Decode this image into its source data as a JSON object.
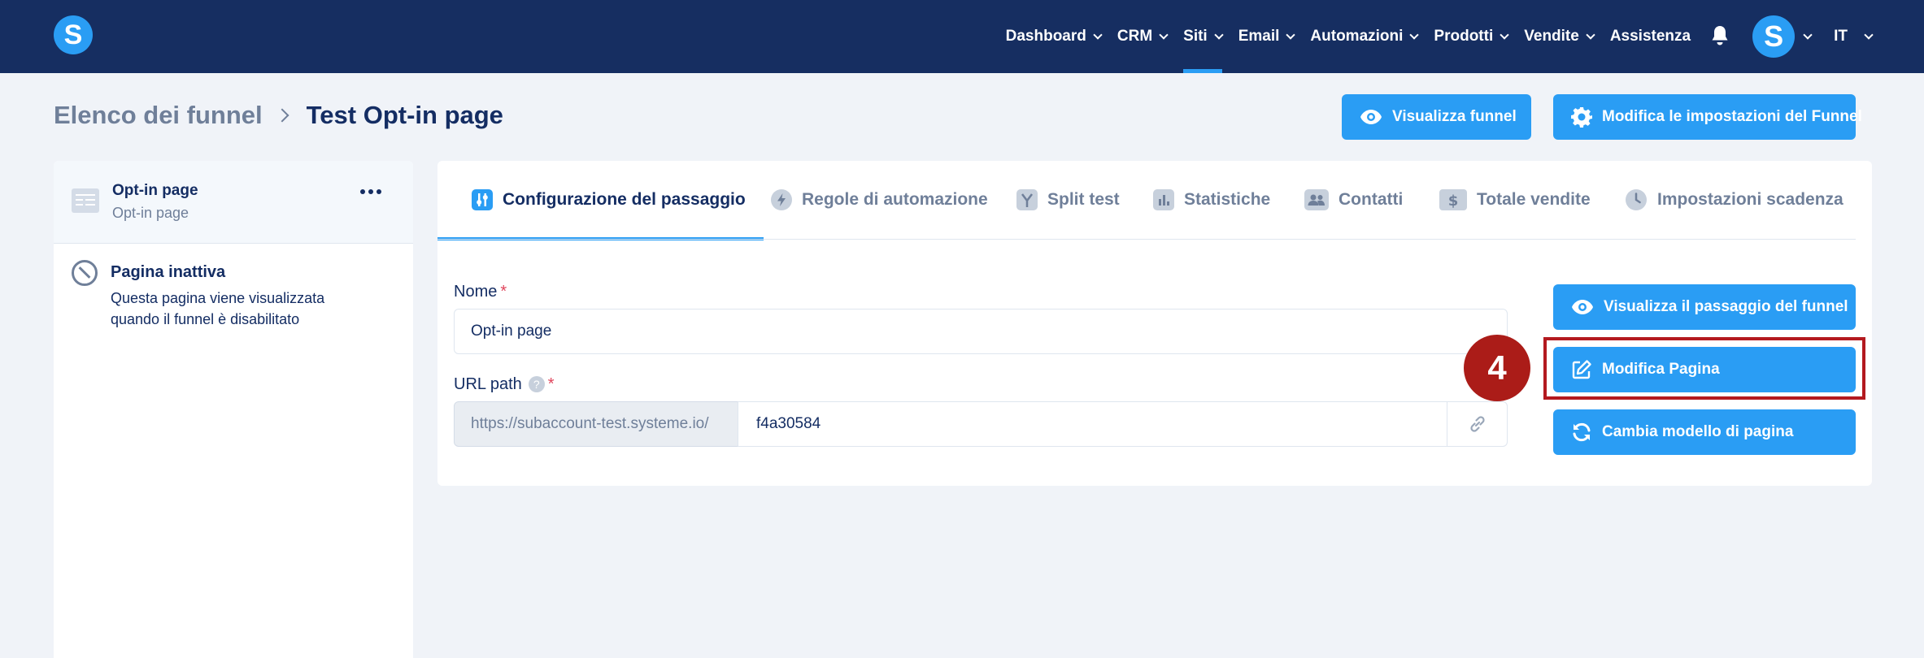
{
  "app": {
    "logo_letter": "S"
  },
  "nav": {
    "items": [
      {
        "label": "Dashboard",
        "dropdown": true,
        "active": false
      },
      {
        "label": "CRM",
        "dropdown": true,
        "active": false
      },
      {
        "label": "Siti",
        "dropdown": true,
        "active": true
      },
      {
        "label": "Email",
        "dropdown": true,
        "active": false
      },
      {
        "label": "Automazioni",
        "dropdown": true,
        "active": false
      },
      {
        "label": "Prodotti",
        "dropdown": true,
        "active": false
      },
      {
        "label": "Vendite",
        "dropdown": true,
        "active": false
      },
      {
        "label": "Assistenza",
        "dropdown": false,
        "active": false
      }
    ],
    "avatar_letter": "S",
    "language": "IT"
  },
  "breadcrumb": {
    "parent": "Elenco dei funnel",
    "current": "Test Opt-in page"
  },
  "header_actions": {
    "view_funnel": "Visualizza funnel",
    "funnel_settings": "Modifica le impostazioni del Funnel"
  },
  "steps": {
    "selected": {
      "title": "Opt-in page",
      "subtitle": "Opt-in page"
    },
    "inactive": {
      "title": "Pagina inattiva",
      "description": "Questa pagina viene visualizzata quando il funnel è disabilitato"
    }
  },
  "tabs": [
    {
      "label": "Configurazione del passaggio",
      "icon": "sliders-icon",
      "active": true
    },
    {
      "label": "Regole di automazione",
      "icon": "bolt-icon",
      "active": false
    },
    {
      "label": "Split test",
      "icon": "split-icon",
      "active": false
    },
    {
      "label": "Statistiche",
      "icon": "bar-chart-icon",
      "active": false
    },
    {
      "label": "Contatti",
      "icon": "users-icon",
      "active": false
    },
    {
      "label": "Totale vendite",
      "icon": "dollar-icon",
      "active": false
    },
    {
      "label": "Impostazioni scadenza",
      "icon": "clock-icon",
      "active": false
    }
  ],
  "form": {
    "name_label": "Nome",
    "name_value": "Opt-in page",
    "required_mark": "*",
    "url_label": "URL path",
    "help_mark": "?",
    "url_prefix": "https://subaccount-test.systeme.io/",
    "url_value": "f4a30584"
  },
  "side_actions": {
    "view_step": "Visualizza il passaggio del funnel",
    "edit_page": "Modifica Pagina",
    "change_template": "Cambia modello di pagina"
  },
  "annotation": {
    "step_number": "4",
    "highlight_color": "#b3191f"
  },
  "colors": {
    "nav_bg": "#162e61",
    "accent": "#2a9df4",
    "text_dark": "#142d63",
    "text_muted": "#6f7f99"
  }
}
